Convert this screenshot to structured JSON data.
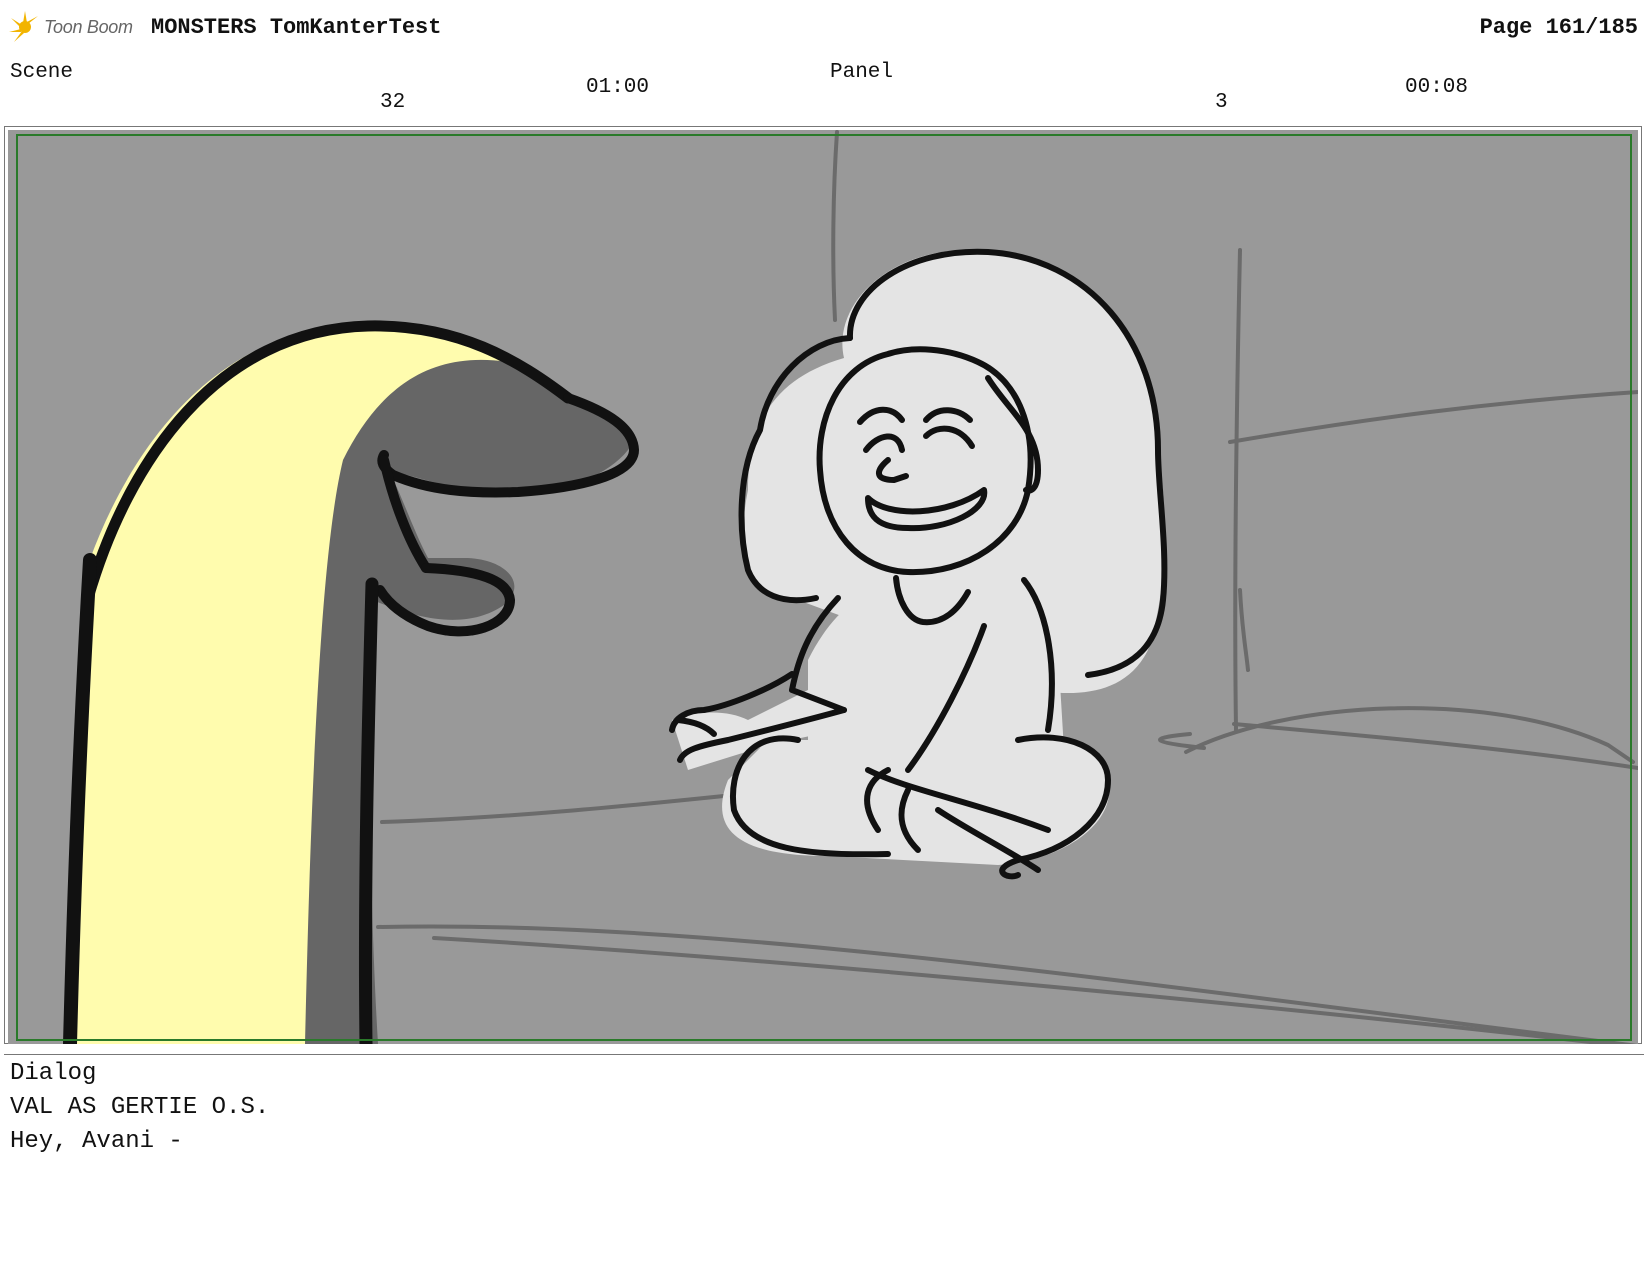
{
  "header": {
    "logo_text": "Toon Boom",
    "title": "MONSTERS TomKanterTest",
    "page": "Page 161/185"
  },
  "scene": {
    "label": "Scene",
    "number": "32",
    "duration": "01:00"
  },
  "panel": {
    "label": "Panel",
    "number": "3",
    "duration": "00:08"
  },
  "dialog": {
    "label": "Dialog",
    "lines": [
      "VAL AS GERTIE O.S.",
      "Hey, Avani -"
    ]
  },
  "colors": {
    "background": "#999999",
    "safe_frame": "#2a7a2a",
    "monster_highlight": "#fffcae",
    "monster_shadow": "#666666",
    "girl_fill": "#e4e4e4"
  }
}
